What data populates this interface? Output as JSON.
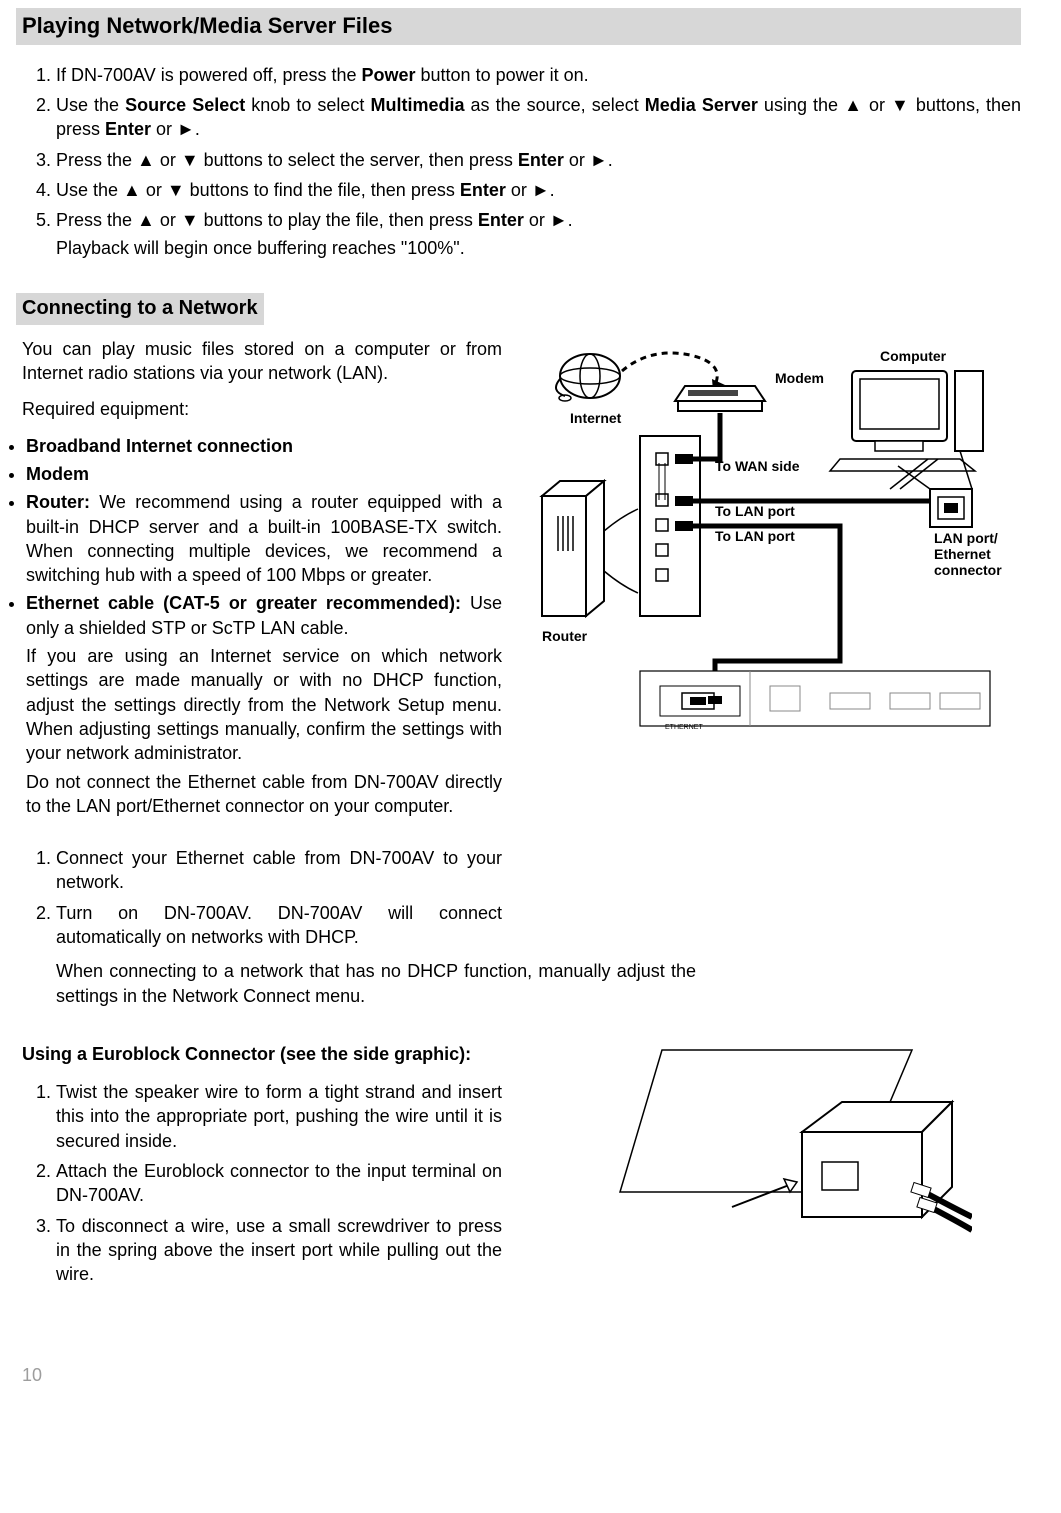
{
  "section1": {
    "title": "Playing Network/Media Server Files",
    "steps": {
      "s1": "If DN-700AV is powered off, press the Power button to power it on.",
      "s2": "Use the Source Select knob to select Multimedia as the source, select Media Server using the ▲ or ▼ buttons, then press Enter or ►.",
      "s3": "Press the ▲ or ▼ buttons to select the server, then press Enter or ►.",
      "s4": "Use the ▲ or ▼ buttons to find the file, then press Enter or ►.",
      "s5": "Press the ▲ or ▼ buttons to play the file, then press Enter or ►.",
      "s5b": "Playback will begin once buffering reaches \"100%\"."
    }
  },
  "section2": {
    "title": "Connecting to a Network",
    "intro1": "You can play music files stored on a computer or from Internet radio stations via your network (LAN).",
    "intro2": "Required equipment:",
    "bullets": {
      "b1": "Broadband Internet connection",
      "b2": "Modem",
      "b3_lead": "Router:",
      "b3_body": " We recommend using a router equipped with a built-in DHCP server and a built-in 100BASE-TX switch. When connecting multiple devices, we recommend a switching hub with a speed of 100 Mbps or greater.",
      "b4_lead": "Ethernet cable (CAT-5 or greater recommended):",
      "b4_body1": " Use only a shielded STP or ScTP LAN cable.",
      "b4_body2": "If you are using an Internet service on which network settings are made manually or with no DHCP function, adjust the settings directly from the Network Setup menu. When adjusting settings manually, confirm the settings with your network administrator.",
      "b4_body3": "Do not connect the Ethernet cable from DN-700AV directly to the LAN port/Ethernet connector on your computer."
    },
    "steps2": {
      "s1": "Connect your Ethernet cable from DN-700AV to your network.",
      "s2a": "Turn on DN-700AV. DN-700AV will connect automatically on networks with DHCP.",
      "s2b": "When connecting to a network that has no DHCP function, manually adjust the settings in the Network Connect menu."
    }
  },
  "diagram": {
    "internet": "Internet",
    "modem": "Modem",
    "computer": "Computer",
    "router": "Router",
    "wan": "To WAN side",
    "lan1": "To LAN port",
    "lan2": "To LAN port",
    "lanport": "LAN port/",
    "ethernet": "Ethernet",
    "connector": "connector",
    "ethlabel": "ETHERNET"
  },
  "section3": {
    "title": "Using a Euroblock Connector (see the side graphic):",
    "s1": "Twist the speaker wire to form a tight strand and insert this into the appropriate port, pushing the wire until it is secured inside.",
    "s2": "Attach the Euroblock connector to the input terminal on DN-700AV.",
    "s3": "To disconnect a wire, use a small screwdriver to press in the spring above the insert port while pulling out the wire."
  },
  "page": "10"
}
